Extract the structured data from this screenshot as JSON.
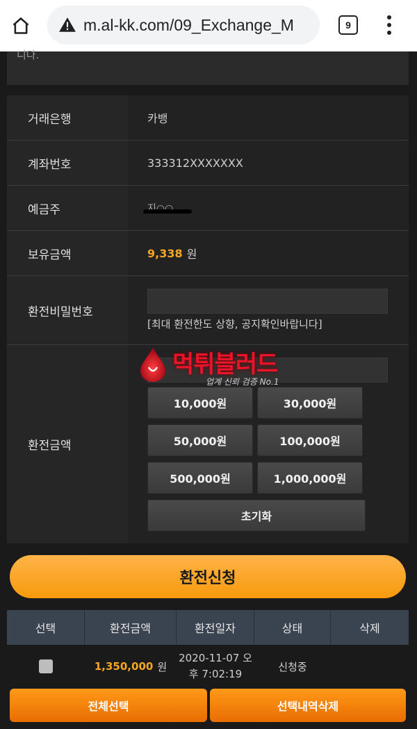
{
  "browser": {
    "url": "m.al-kk.com/09_Exchange_M",
    "tab_count": "9"
  },
  "notice": {
    "text": "니다."
  },
  "form": {
    "bank_label": "거래은행",
    "bank_value": "카뱅",
    "account_label": "계좌번호",
    "account_value": "333312XXXXXXX",
    "holder_label": "예금주",
    "holder_value": "지○○",
    "balance_label": "보유금액",
    "balance_value": "9,338",
    "balance_unit": "원",
    "password_label": "환전비밀번호",
    "password_hint": "[최대 환전한도 상향, 공지확인바랍니다]",
    "amount_label": "환전금액",
    "amount_buttons": [
      "10,000원",
      "30,000원",
      "50,000원",
      "100,000원",
      "500,000원",
      "1,000,000원"
    ],
    "reset_label": "초기화"
  },
  "watermark": {
    "title": "먹튀블러드",
    "subtitle": "업계 신뢰 검증 No.1"
  },
  "submit_label": "환전신청",
  "history": {
    "headers": [
      "선택",
      "환전금액",
      "환전일자",
      "상태",
      "삭제"
    ],
    "rows": [
      {
        "amount": "1,350,000",
        "unit": "원",
        "date_line1": "2020-11-07 오",
        "date_line2": "후 7:02:19",
        "status": "신청중"
      }
    ]
  },
  "actions": {
    "select_all": "전체선택",
    "delete_selected": "선택내역삭제"
  },
  "colors": {
    "accent": "#f79a0d",
    "gold_text": "#f5a623",
    "header_bg": "#3a4350"
  }
}
